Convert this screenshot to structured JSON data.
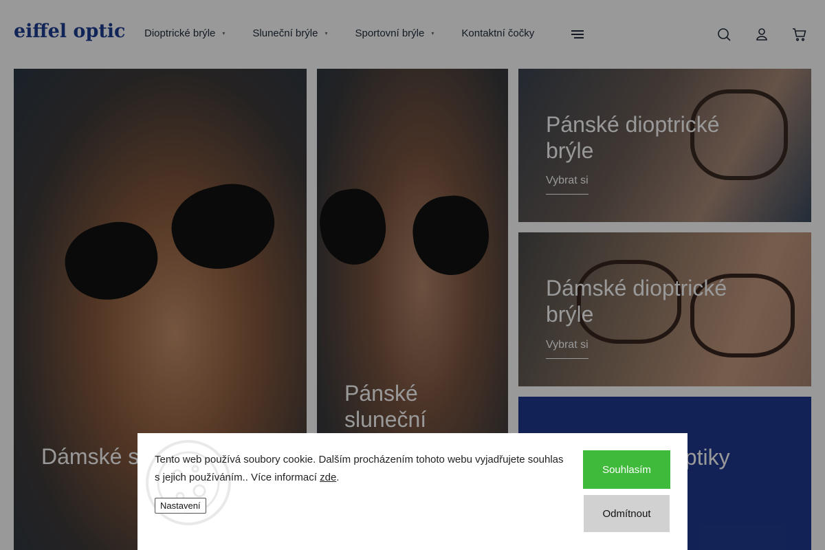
{
  "brand": {
    "logo_text": "eiffel optic",
    "color": "#1f3f93"
  },
  "nav": {
    "items": [
      {
        "label": "Dioptrické brýle",
        "has_dropdown": true
      },
      {
        "label": "Sluneční brýle",
        "has_dropdown": true
      },
      {
        "label": "Sportovní brýle",
        "has_dropdown": true
      },
      {
        "label": "Kontaktní čočky",
        "has_dropdown": false
      }
    ],
    "caret_glyph": "▾",
    "menu_icon": "hamburger-icon"
  },
  "header_icons": [
    "search-icon",
    "user-icon",
    "cart-icon"
  ],
  "tiles": [
    {
      "title": "Dámské sluneční brýle",
      "visible_title": "Dámské s"
    },
    {
      "title": "Pánské sluneční brýle",
      "line1": "Pánské",
      "line2": "sluneční"
    },
    {
      "title": "Pánské dioptrické brýle",
      "line1": "Pánské dioptrické",
      "line2": "brýle",
      "link": "Vybrat si"
    },
    {
      "title": "Dámské dioptrické brýle",
      "line1": "Dámské dioptrické",
      "line2": "brýle",
      "link": "Vybrat si"
    },
    {
      "title": "…optiky",
      "visible_title": "optiky",
      "background": "#1f3a8f"
    }
  ],
  "cookie": {
    "text": "Tento web používá soubory cookie. Dalším procházením tohoto webu vyjadřujete souhlas s jejich používáním.. Více informací ",
    "link_text": "zde",
    "after_link": ".",
    "settings_label": "Nastavení",
    "accept_label": "Souhlasím",
    "reject_label": "Odmítnout",
    "accept_color": "#3fba3b",
    "reject_color": "#d1d1d1"
  }
}
